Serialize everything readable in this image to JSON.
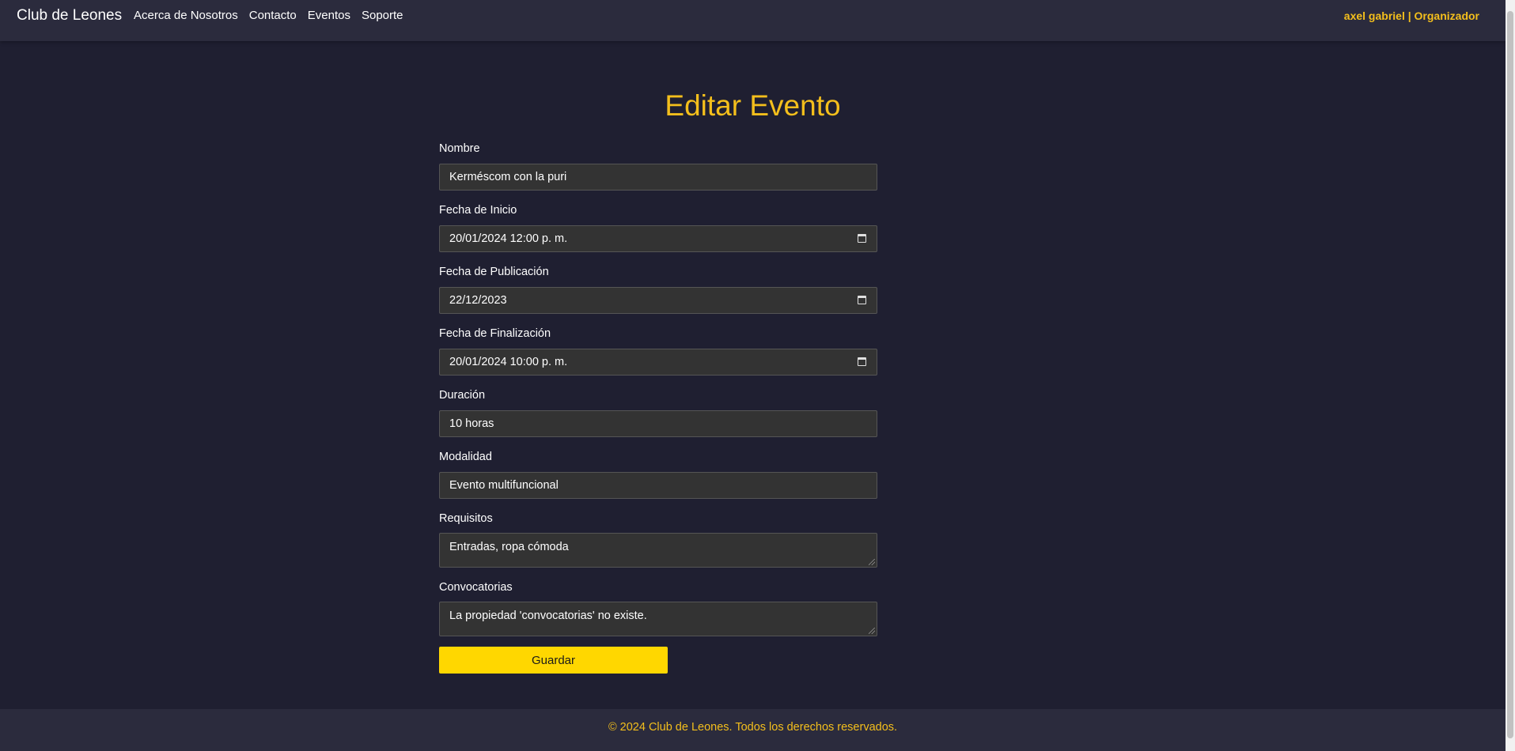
{
  "nav": {
    "brand": "Club de Leones",
    "links": [
      "Acerca de Nosotros",
      "Contacto",
      "Eventos",
      "Soporte"
    ],
    "user": "axel gabriel | Organizador"
  },
  "page": {
    "title": "Editar Evento"
  },
  "form": {
    "nombre": {
      "label": "Nombre",
      "value": "Kerméscom con la puri"
    },
    "fecha_inicio": {
      "label": "Fecha de Inicio",
      "value": "20/01/2024 12:00 p. m."
    },
    "fecha_publicacion": {
      "label": "Fecha de Publicación",
      "value": "22/12/2023"
    },
    "fecha_finalizacion": {
      "label": "Fecha de Finalización",
      "value": "20/01/2024 10:00 p. m."
    },
    "duracion": {
      "label": "Duración",
      "value": "10 horas"
    },
    "modalidad": {
      "label": "Modalidad",
      "value": "Evento multifuncional"
    },
    "requisitos": {
      "label": "Requisitos",
      "value": "Entradas, ropa cómoda"
    },
    "convocatorias": {
      "label": "Convocatorias",
      "value": "La propiedad 'convocatorias' no existe."
    },
    "save_label": "Guardar"
  },
  "footer": {
    "text": "© 2024 Club de Leones. Todos los derechos reservados."
  },
  "colors": {
    "accent": "#f4bf1c",
    "button": "#ffd700",
    "background": "#1f1f31",
    "navbar": "#2b2b3d",
    "field": "#333333"
  }
}
